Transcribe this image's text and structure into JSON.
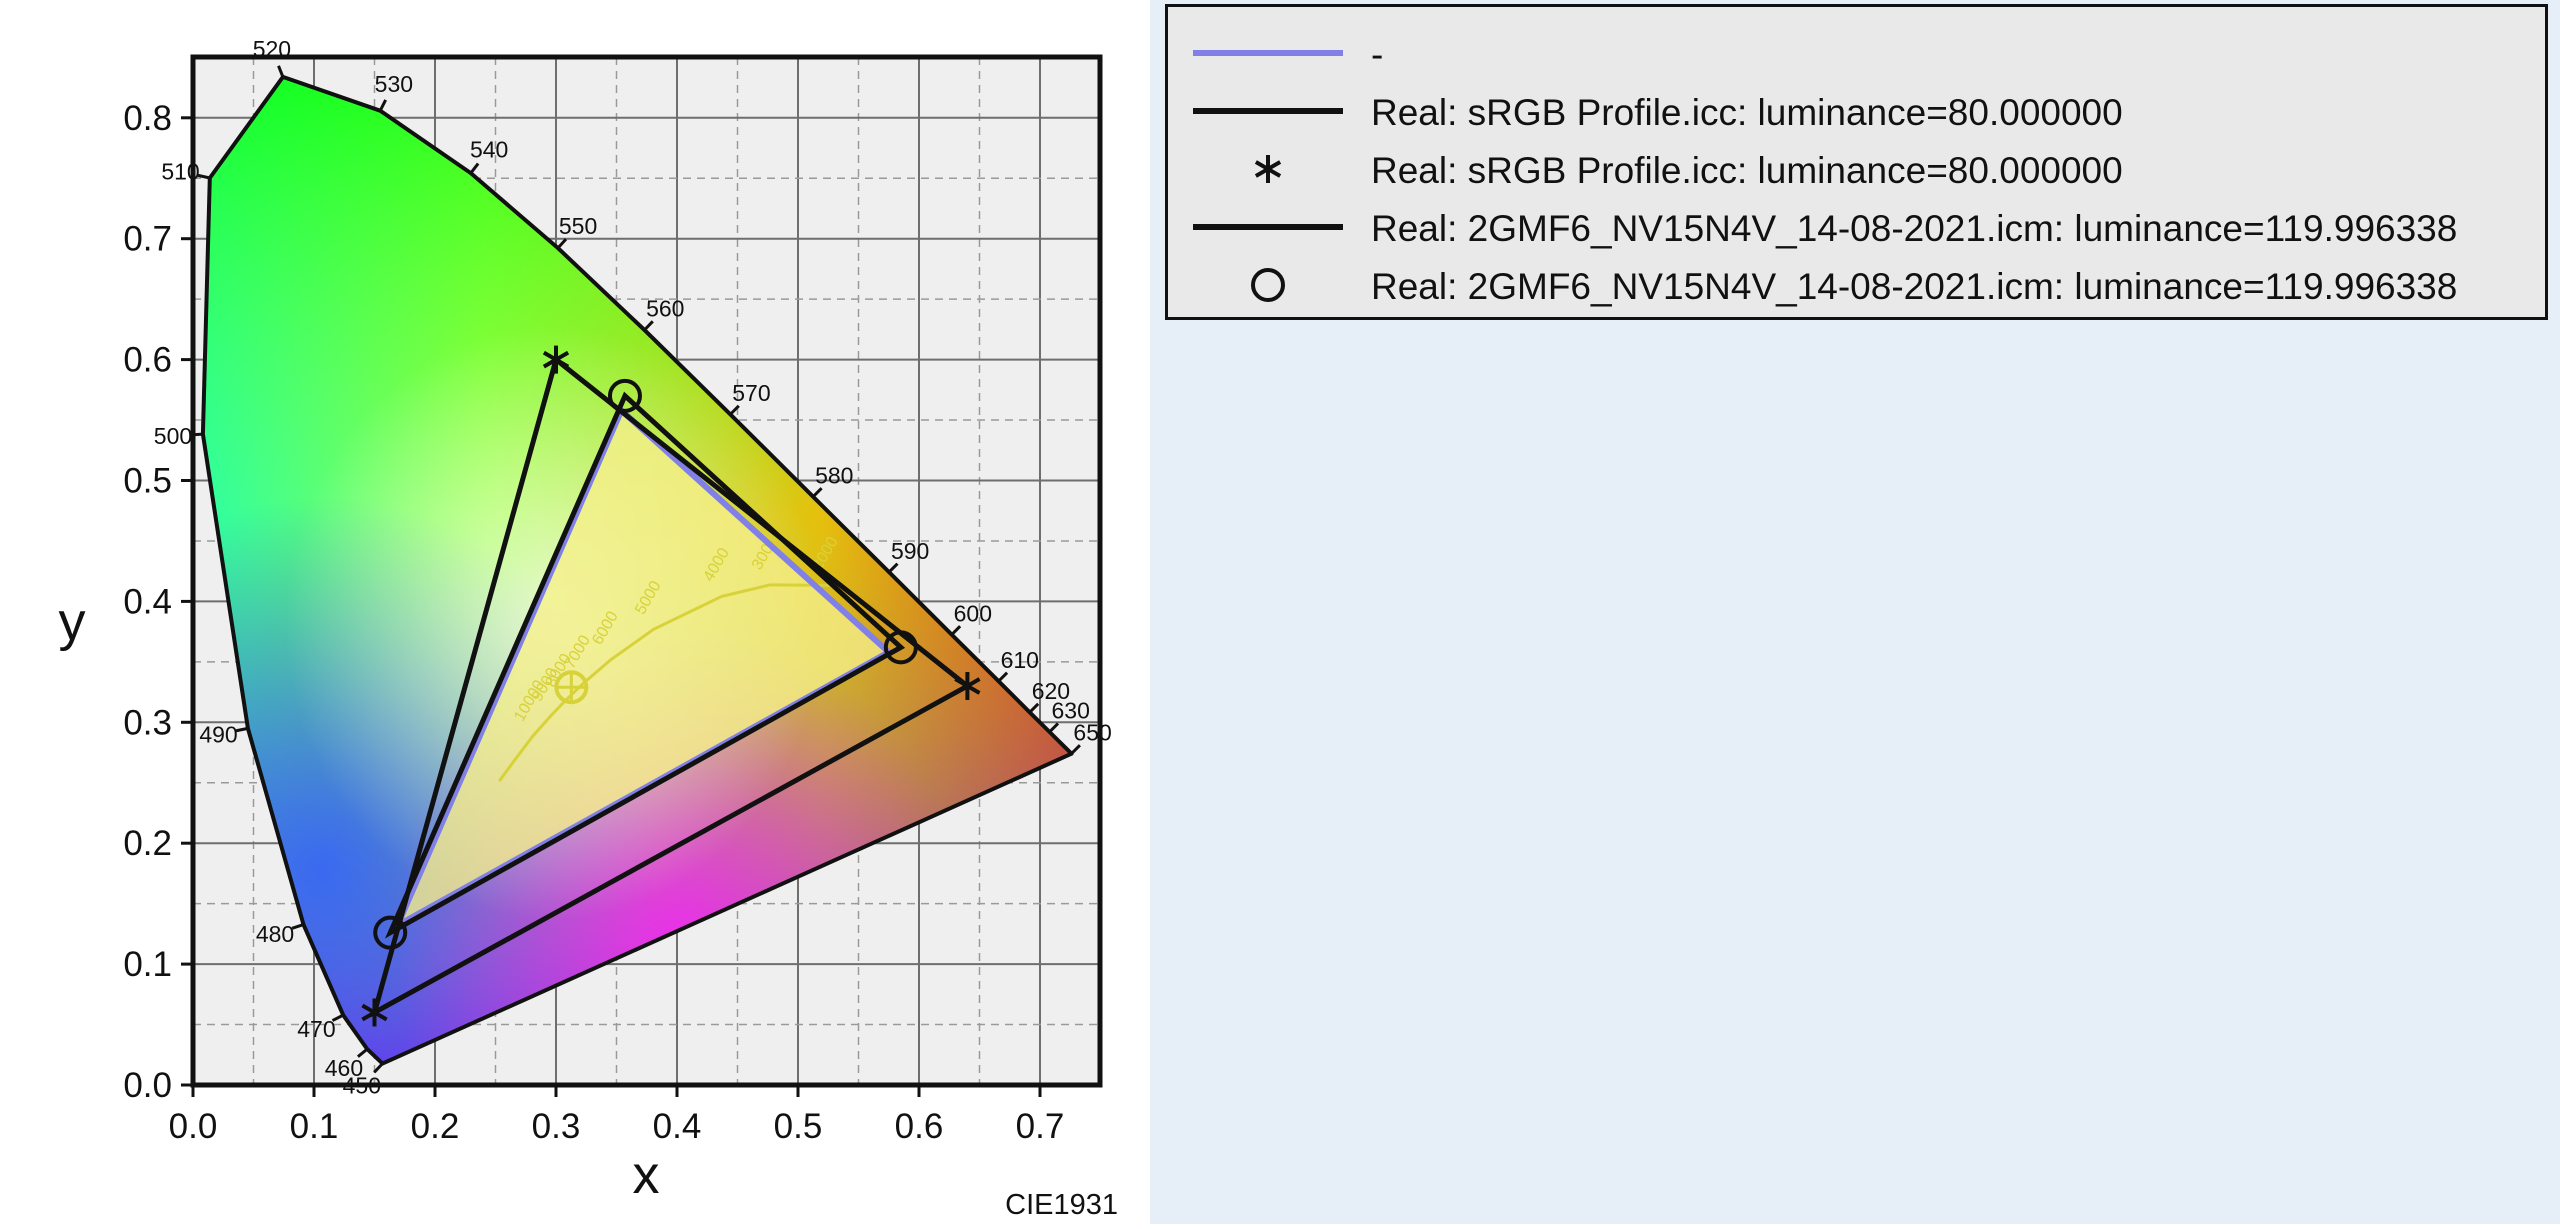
{
  "chart_data": {
    "type": "scatter",
    "diagram": "CIE1931",
    "xlabel": "x",
    "ylabel": "y",
    "xlim": [
      0.0,
      0.75
    ],
    "ylim": [
      0.0,
      0.85
    ],
    "xticks": [
      "0.0",
      "0.1",
      "0.2",
      "0.3",
      "0.4",
      "0.5",
      "0.6",
      "0.7"
    ],
    "yticks": [
      "0.0",
      "0.1",
      "0.2",
      "0.3",
      "0.4",
      "0.5",
      "0.6",
      "0.7",
      "0.8"
    ],
    "grid": true,
    "legend_position": "right",
    "spectral_locus": [
      {
        "nm": 450,
        "x": 0.1566,
        "y": 0.0177
      },
      {
        "nm": 460,
        "x": 0.144,
        "y": 0.0297
      },
      {
        "nm": 470,
        "x": 0.1241,
        "y": 0.0578
      },
      {
        "nm": 480,
        "x": 0.0913,
        "y": 0.1327
      },
      {
        "nm": 490,
        "x": 0.0454,
        "y": 0.295
      },
      {
        "nm": 500,
        "x": 0.0082,
        "y": 0.5384
      },
      {
        "nm": 510,
        "x": 0.0139,
        "y": 0.7502
      },
      {
        "nm": 520,
        "x": 0.0743,
        "y": 0.8338
      },
      {
        "nm": 530,
        "x": 0.1547,
        "y": 0.8059
      },
      {
        "nm": 540,
        "x": 0.2296,
        "y": 0.7543
      },
      {
        "nm": 550,
        "x": 0.3016,
        "y": 0.6923
      },
      {
        "nm": 560,
        "x": 0.3731,
        "y": 0.6245
      },
      {
        "nm": 570,
        "x": 0.4441,
        "y": 0.5547
      },
      {
        "nm": 580,
        "x": 0.5125,
        "y": 0.4866
      },
      {
        "nm": 590,
        "x": 0.5752,
        "y": 0.4242
      },
      {
        "nm": 600,
        "x": 0.627,
        "y": 0.3725
      },
      {
        "nm": 610,
        "x": 0.6658,
        "y": 0.334
      },
      {
        "nm": 620,
        "x": 0.6915,
        "y": 0.3083
      },
      {
        "nm": 630,
        "x": 0.7079,
        "y": 0.292
      },
      {
        "nm": 650,
        "x": 0.726,
        "y": 0.274
      }
    ],
    "planckian_locus": {
      "color": "#d8d23a",
      "points": [
        {
          "x": 0.5268,
          "y": 0.4133
        },
        {
          "x": 0.477,
          "y": 0.4137
        },
        {
          "x": 0.4369,
          "y": 0.4041
        },
        {
          "x": 0.3805,
          "y": 0.3768
        },
        {
          "x": 0.3451,
          "y": 0.3516
        },
        {
          "x": 0.3221,
          "y": 0.3318
        },
        {
          "x": 0.3064,
          "y": 0.3166
        },
        {
          "x": 0.2952,
          "y": 0.3048
        },
        {
          "x": 0.2806,
          "y": 0.2883
        },
        {
          "x": 0.2648,
          "y": 0.2673
        },
        {
          "x": 0.2531,
          "y": 0.2514
        }
      ],
      "cct_labels": [
        "2000",
        "3000",
        "4000",
        "5000",
        "6000",
        "7000",
        "8000",
        "9000",
        "10000"
      ],
      "white_point": {
        "x": 0.3127,
        "y": 0.329
      }
    },
    "series": [
      {
        "name": "-",
        "color": "#8080e6",
        "style": "line",
        "points": [
          {
            "x": 0.575,
            "y": 0.358
          },
          {
            "x": 0.354,
            "y": 0.558
          },
          {
            "x": 0.169,
            "y": 0.132
          }
        ]
      },
      {
        "name": "Real: sRGB Profile.icc: luminance=80.000000",
        "color": "#111111",
        "style": "line",
        "points": [
          {
            "x": 0.64,
            "y": 0.33
          },
          {
            "x": 0.3,
            "y": 0.6
          },
          {
            "x": 0.15,
            "y": 0.06
          }
        ]
      },
      {
        "name": "Real: sRGB Profile.icc: luminance=80.000000",
        "color": "#111111",
        "style": "marker-star",
        "points": [
          {
            "x": 0.64,
            "y": 0.33
          },
          {
            "x": 0.3,
            "y": 0.6
          },
          {
            "x": 0.15,
            "y": 0.06
          }
        ]
      },
      {
        "name": "Real: 2GMF6_NV15N4V_14-08-2021.icm: luminance=119.996338",
        "color": "#111111",
        "style": "line",
        "points": [
          {
            "x": 0.585,
            "y": 0.362
          },
          {
            "x": 0.357,
            "y": 0.57
          },
          {
            "x": 0.163,
            "y": 0.126
          }
        ]
      },
      {
        "name": "Real: 2GMF6_NV15N4V_14-08-2021.icm: luminance=119.996338",
        "color": "#111111",
        "style": "marker-circle",
        "points": [
          {
            "x": 0.585,
            "y": 0.362
          },
          {
            "x": 0.357,
            "y": 0.57
          },
          {
            "x": 0.163,
            "y": 0.126
          }
        ]
      }
    ]
  }
}
